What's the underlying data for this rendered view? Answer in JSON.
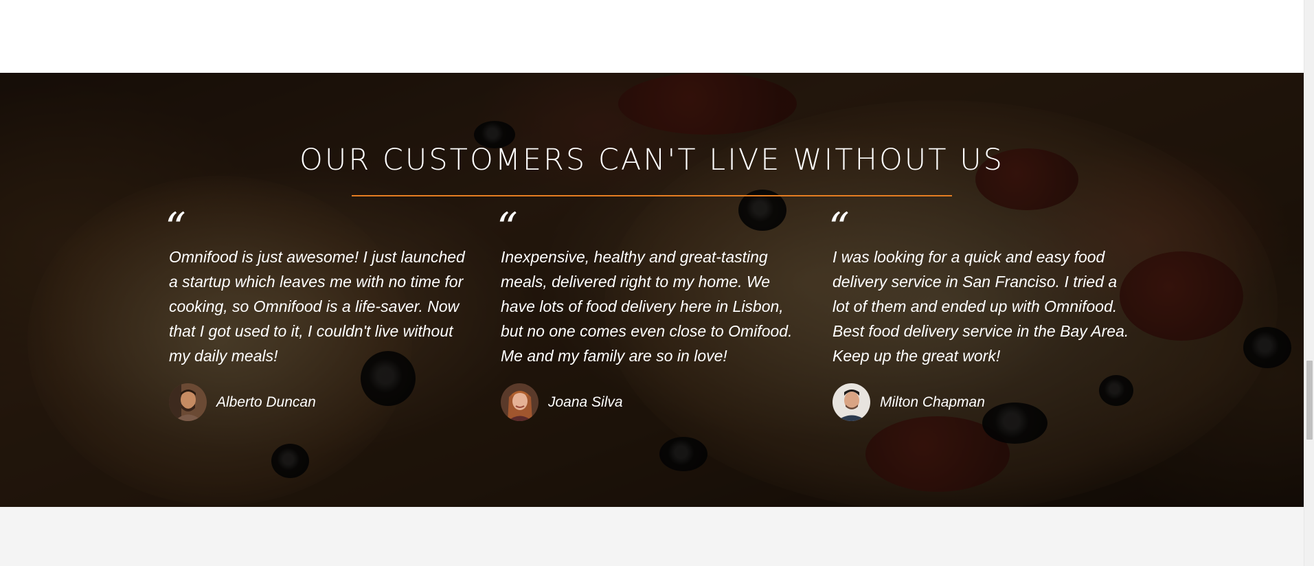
{
  "section": {
    "title": "OUR CUSTOMERS CAN'T LIVE WITHOUT US",
    "accent_color": "#e67e22",
    "background_image": "pizza-photo-dark-overlay"
  },
  "testimonials": [
    {
      "quote_mark": "“",
      "text": "Omnifood is just awesome! I just launched a startup which leaves me with no time for cooking, so Omnifood is a life-saver. Now that I got used to it, I couldn't live without my daily meals!",
      "author": "Alberto Duncan",
      "avatar_icon": "customer-avatar-man"
    },
    {
      "quote_mark": "“",
      "text": "Inexpensive, healthy and great-tasting meals, delivered right to my home. We have lots of food delivery here in Lisbon, but no one comes even close to Omifood. Me and my family are so in love!",
      "author": "Joana Silva",
      "avatar_icon": "customer-avatar-woman"
    },
    {
      "quote_mark": "“",
      "text": "I was looking for a quick and easy food delivery service in San Franciso. I tried a lot of them and ended up with Omnifood. Best food delivery service in the Bay Area. Keep up the great work!",
      "author": "Milton Chapman",
      "avatar_icon": "customer-avatar-man"
    }
  ]
}
